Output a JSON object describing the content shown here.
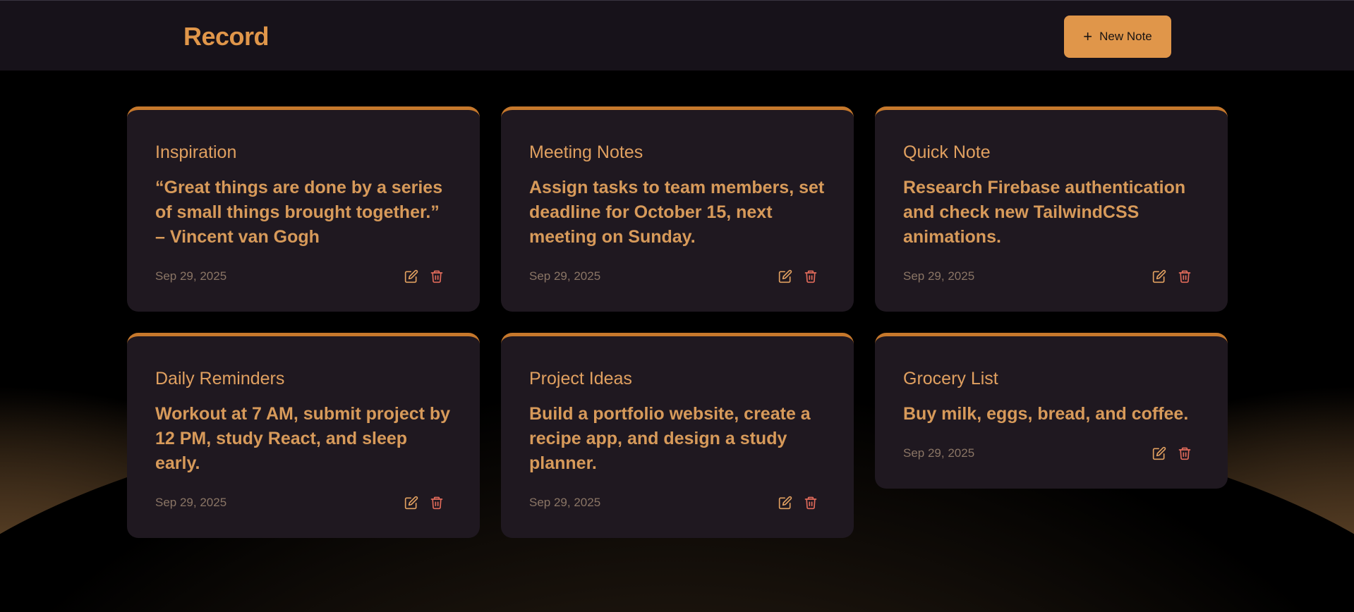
{
  "app": {
    "brand": "Record",
    "new_note_label": "New Note"
  },
  "colors": {
    "accent": "#e0964a",
    "card_bg": "#1f1820",
    "header_bg": "#17121a",
    "delete": "#e06a5a"
  },
  "notes": [
    {
      "title": "Inspiration",
      "body": "“Great things are done by a series of small things brought together.” – Vincent van Gogh",
      "date": "Sep 29, 2025"
    },
    {
      "title": "Meeting Notes",
      "body": "Assign tasks to team members, set deadline for October 15, next meeting on Sunday.",
      "date": "Sep 29, 2025"
    },
    {
      "title": "Quick Note",
      "body": "Research Firebase authentication and check new TailwindCSS animations.",
      "date": "Sep 29, 2025"
    },
    {
      "title": "Daily Reminders",
      "body": "Workout at 7 AM, submit project by 12 PM, study React, and sleep early.",
      "date": "Sep 29, 2025"
    },
    {
      "title": "Project Ideas",
      "body": "Build a portfolio website, create a recipe app, and design a study planner.",
      "date": "Sep 29, 2025"
    },
    {
      "title": "Grocery List",
      "body": "Buy milk, eggs, bread, and coffee.",
      "date": "Sep 29, 2025"
    }
  ],
  "icons": {
    "add": "plus-icon",
    "edit": "edit-icon",
    "delete": "trash-icon"
  }
}
